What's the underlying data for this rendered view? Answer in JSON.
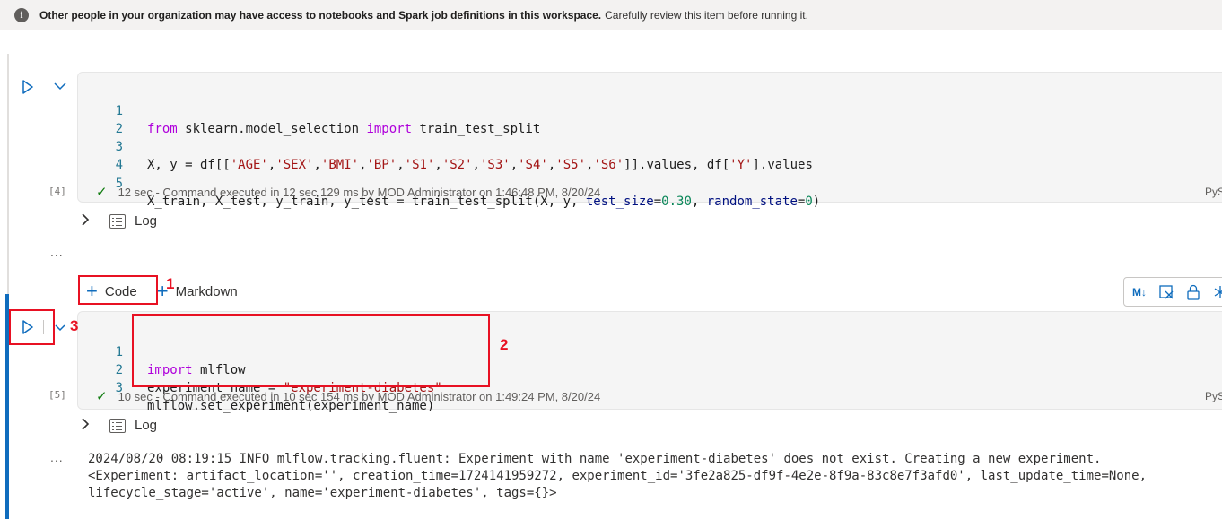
{
  "banner": {
    "bold": "Other people in your organization may have access to notebooks and Spark job definitions in this workspace.",
    "rest": "Carefully review this item before running it."
  },
  "cell1": {
    "exec_count": "[4]",
    "lines": [
      {
        "n": "1"
      },
      {
        "n": "2"
      },
      {
        "n": "3"
      },
      {
        "n": "4"
      },
      {
        "n": "5"
      }
    ],
    "status": "12 sec - Command executed in 12 sec 129 ms by MOD Administrator on 1:46:48 PM, 8/20/24",
    "lang": "PyS"
  },
  "cell2": {
    "exec_count": "[5]",
    "lines": [
      {
        "n": "1"
      },
      {
        "n": "2"
      },
      {
        "n": "3"
      }
    ],
    "status": "10 sec - Command executed in 10 sec 154 ms by MOD Administrator on 1:49:24 PM, 8/20/24",
    "lang": "PyS"
  },
  "log_label": "Log",
  "ellipsis": "...",
  "add_cell": {
    "code_label": "Code",
    "markdown_label": "Markdown"
  },
  "cell_toolbar": {
    "md_label": "M↓"
  },
  "output": {
    "line1": "2024/08/20 08:19:15 INFO mlflow.tracking.fluent: Experiment with name 'experiment-diabetes' does not exist. Creating a new experiment.",
    "line2": "<Experiment: artifact_location='', creation_time=1724141959272, experiment_id='3fe2a825-df9f-4e2e-8f9a-83c8e7f3afd0', last_update_time=None,",
    "line3": "lifecycle_stage='active', name='experiment-diabetes', tags={}>"
  },
  "annotations": {
    "one": "1",
    "two": "2",
    "three": "3"
  },
  "colors": {
    "accent": "#0f6cbd",
    "annotation_red": "#e81123",
    "success": "#107c10"
  }
}
